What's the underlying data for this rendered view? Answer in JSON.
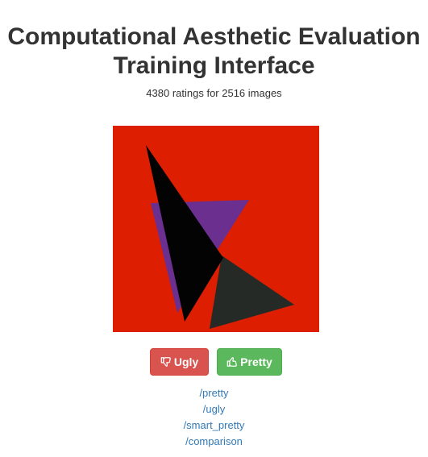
{
  "header": {
    "title_line1": "Computational Aesthetic Evaluation",
    "title_line2": "Training Interface",
    "subtitle": "4380 ratings for 2516 images"
  },
  "image": {
    "background_color": "#dd1e00",
    "shapes": [
      {
        "name": "purple-triangle",
        "color": "#6b2f8f"
      },
      {
        "name": "dark-gray-triangle",
        "color": "#262a27"
      },
      {
        "name": "black-triangle",
        "color": "#030303"
      }
    ]
  },
  "buttons": {
    "ugly_label": "Ugly",
    "ugly_icon": "thumbs-down-icon",
    "ugly_color": "#d9534f",
    "pretty_label": "Pretty",
    "pretty_icon": "thumbs-up-icon",
    "pretty_color": "#5cb85c"
  },
  "links": [
    {
      "label": "/pretty"
    },
    {
      "label": "/ugly"
    },
    {
      "label": "/smart_pretty"
    },
    {
      "label": "/comparison"
    }
  ]
}
